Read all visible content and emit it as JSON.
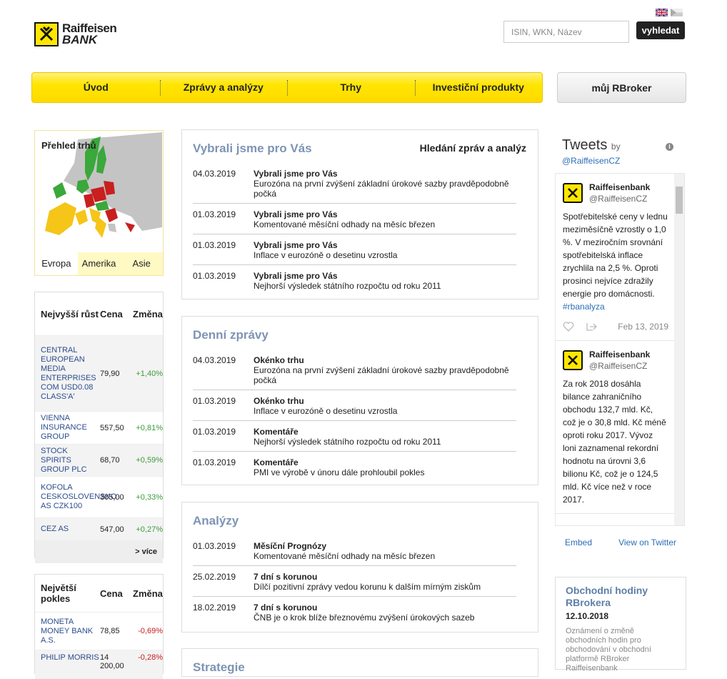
{
  "brand": {
    "line1": "Raiffeisen",
    "line2": "BANK"
  },
  "search": {
    "placeholder": "ISIN, WKN, Název",
    "button": "vyhledat"
  },
  "nav": {
    "items": [
      "Úvod",
      "Zprávy a analýzy",
      "Trhy",
      "Investiční produkty"
    ],
    "rbroker": "můj RBroker"
  },
  "map": {
    "title": "Přehled trhů",
    "tabs": [
      "Evropa",
      "Amerika",
      "Asie"
    ]
  },
  "gainers": {
    "headers": [
      "Nejvyšší růst",
      "Cena",
      "Změna"
    ],
    "rows": [
      {
        "name": "CENTRAL EUROPEAN MEDIA ENTERPRISES COM USD0.08 CLASS'A'",
        "price": "79,90",
        "change": "+1,40%"
      },
      {
        "name": "VIENNA INSURANCE GROUP",
        "price": "557,50",
        "change": "+0,81%"
      },
      {
        "name": "STOCK SPIRITS GROUP PLC",
        "price": "68,70",
        "change": "+0,59%"
      },
      {
        "name": "KOFOLA CESKOSLOVENSKO AS CZK100",
        "price": "305,00",
        "change": "+0,33%"
      },
      {
        "name": "CEZ AS",
        "price": "547,00",
        "change": "+0,27%"
      }
    ],
    "more": "> více"
  },
  "losers": {
    "headers": [
      "Největší pokles",
      "Cena",
      "Změna"
    ],
    "rows": [
      {
        "name": "MONETA MONEY BANK A.S.",
        "price": "78,85",
        "change": "-0,69%"
      },
      {
        "name": "PHILIP MORRIS",
        "price": "14 200,00",
        "change": "-0,28%"
      }
    ]
  },
  "chosen": {
    "title": "Vybrali jsme pro Vás",
    "search_link": "Hledání zpráv a analýz",
    "items": [
      {
        "date": "04.03.2019",
        "title": "Vybrali jsme pro Vás",
        "text": "Eurozóna na první zvýšení základní úrokové sazby pravděpodobně počká"
      },
      {
        "date": "01.03.2019",
        "title": "Vybrali jsme pro Vás",
        "text": "Komentované měsíční odhady na měsíc březen"
      },
      {
        "date": "01.03.2019",
        "title": "Vybrali jsme pro Vás",
        "text": "Inflace v eurozóně o desetinu vzrostla"
      },
      {
        "date": "01.03.2019",
        "title": "Vybrali jsme pro Vás",
        "text": "Nejhorší výsledek státního rozpočtu od roku 2011"
      }
    ]
  },
  "daily": {
    "title": "Denní zprávy",
    "items": [
      {
        "date": "04.03.2019",
        "title": "Okénko trhu",
        "text": "Eurozóna na první zvýšení základní úrokové sazby pravděpodobně počká"
      },
      {
        "date": "01.03.2019",
        "title": "Okénko trhu",
        "text": "Inflace v eurozóně o desetinu vzrostla"
      },
      {
        "date": "01.03.2019",
        "title": "Komentáře",
        "text": "Nejhorší výsledek státního rozpočtu od roku 2011"
      },
      {
        "date": "01.03.2019",
        "title": "Komentáře",
        "text": "PMI ve výrobě v únoru dále prohloubil pokles"
      }
    ]
  },
  "analyses": {
    "title": "Analýzy",
    "items": [
      {
        "date": "01.03.2019",
        "title": "Měsíční Prognózy",
        "text": "Komentované měsíční odhady na měsíc březen"
      },
      {
        "date": "25.02.2019",
        "title": "7 dní s korunou",
        "text": "Dílčí pozitivní zprávy vedou korunu k dalším mírným ziskům"
      },
      {
        "date": "18.02.2019",
        "title": "7 dní s korunou",
        "text": "ČNB je o krok blíže březnovému zvýšení úrokových sazeb"
      }
    ]
  },
  "strategies": {
    "title": "Strategie"
  },
  "tweets": {
    "title": "Tweets",
    "by": "by",
    "account": "@RaiffeisenCZ",
    "items": [
      {
        "name": "Raiffeisenbank",
        "handle": "@RaiffeisenCZ",
        "text": "Spotřebitelské ceny v lednu meziměsíčně vzrostly o 1,0 %. V meziročním srovnání spotřebitelská inflace zrychlila na 2,5 %. Oproti prosinci nejvíce zdražily energie pro domácnosti.",
        "tag": "#rbanalyza",
        "date": "Feb 13, 2019"
      },
      {
        "name": "Raiffeisenbank",
        "handle": "@RaiffeisenCZ",
        "text": "Za rok 2018 dosáhla bilance zahraničního obchodu 132,7 mld. Kč, což je o 30,8 mld. Kč méně oproti roku 2017. Vývoz loni zaznamenal rekordní hodnotu na úrovni 3,6 bilionu Kč, což je o 124,5 mld. Kč více než v roce 2017.",
        "tag": "",
        "date": ""
      }
    ],
    "embed": "Embed",
    "view": "View on Twitter"
  },
  "hours": {
    "title": "Obchodní hodiny RBrokera",
    "date": "12.10.2018",
    "text": "Oznámení o změně obchodních hodin pro obchodování v obchodní platformě RBroker Raiffeisenbank"
  }
}
